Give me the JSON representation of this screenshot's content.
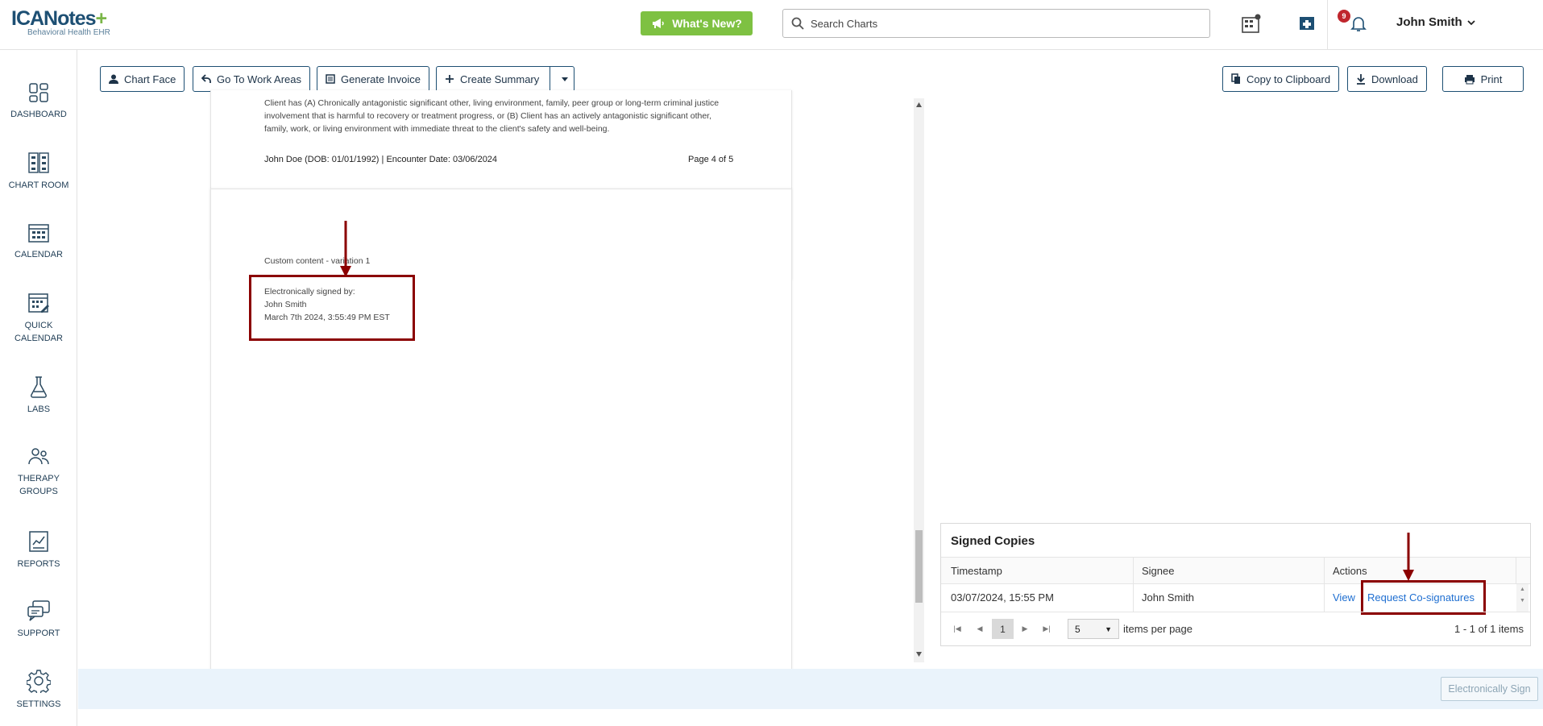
{
  "app": {
    "logo_text": "ICANotes",
    "logo_plus": "+",
    "logo_sub": "Behavioral Health EHR",
    "whats_new": "What's New?",
    "search_placeholder": "Search Charts",
    "notification_count": "9",
    "user_name": "John Smith"
  },
  "sidebar": {
    "items": [
      {
        "label": "DASHBOARD",
        "icon": "dashboard-icon"
      },
      {
        "label": "CHART ROOM",
        "icon": "chart-room-icon"
      },
      {
        "label": "CALENDAR",
        "icon": "calendar-icon"
      },
      {
        "label": "QUICK CALENDAR",
        "icon": "quick-calendar-icon"
      },
      {
        "label": "LABS",
        "icon": "flask-icon"
      },
      {
        "label": "THERAPY GROUPS",
        "icon": "group-icon"
      },
      {
        "label": "REPORTS",
        "icon": "report-icon"
      },
      {
        "label": "SUPPORT",
        "icon": "chat-icon"
      },
      {
        "label": "SETTINGS",
        "icon": "gear-icon"
      }
    ]
  },
  "toolbar": {
    "chart_face": "Chart Face",
    "go_to_work_areas": "Go To Work Areas",
    "generate_invoice": "Generate Invoice",
    "create_summary": "Create Summary",
    "copy_clipboard": "Copy to Clipboard",
    "download": "Download",
    "print": "Print"
  },
  "document": {
    "page4_text": "Client has (A) Chronically antagonistic significant other, living environment, family, peer group or long-term criminal justice involvement that is harmful to recovery or treatment progress, or (B) Client has an actively antagonistic significant other, family, work, or living environment with immediate threat to the client's safety and well-being.",
    "page4_footer_left": "John Doe (DOB: 01/01/1992) | Encounter Date: 03/06/2024",
    "page4_footer_right": "Page 4 of 5",
    "custom_content": "Custom content - variation 1",
    "signed_by_label": "Electronically signed by:",
    "signed_by_name": "John Smith",
    "signed_date": "March 7th 2024, 3:55:49 PM EST"
  },
  "signed_copies": {
    "title": "Signed Copies",
    "columns": [
      "Timestamp",
      "Signee",
      "Actions"
    ],
    "rows": [
      {
        "timestamp": "03/07/2024, 15:55 PM",
        "signee": "John Smith",
        "view": "View",
        "request": "Request Co-signatures"
      }
    ],
    "current_page": "1",
    "page_size": "5",
    "items_per_page": "items per page",
    "info": "1 - 1 of 1 items"
  },
  "footer": {
    "esign": "Electronically Sign"
  },
  "colors": {
    "brand_navy": "#1d4f73",
    "brand_green": "#7ec142",
    "annotation_red": "#8b0000",
    "link_blue": "#1f6fd1"
  }
}
